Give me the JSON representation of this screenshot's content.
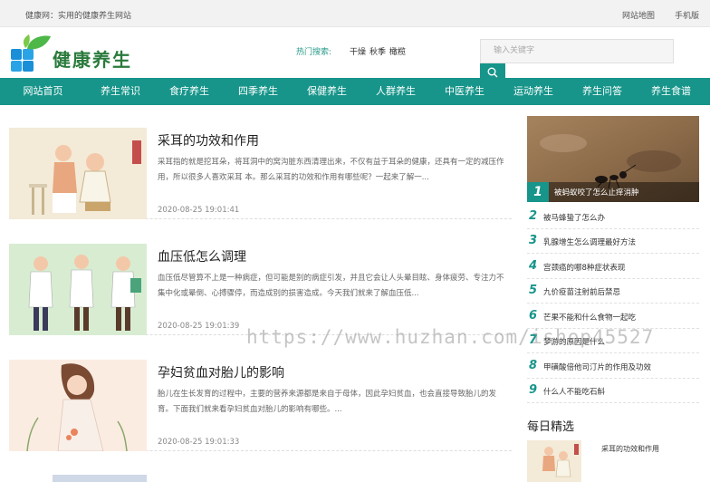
{
  "topbar": {
    "site_intro": "健康网：实用的健康养生网站",
    "links": [
      "网站地图",
      "手机版"
    ]
  },
  "header": {
    "logo_text": "健康养生",
    "hot_label": "热门搜索:",
    "hot_words": [
      "干燥",
      "秋季",
      "橄榄"
    ],
    "search_placeholder": "输入关键字"
  },
  "nav": [
    "网站首页",
    "养生常识",
    "食疗养生",
    "四季养生",
    "保健养生",
    "人群养生",
    "中医养生",
    "运动养生",
    "养生问答",
    "养生食谱"
  ],
  "articles": [
    {
      "title": "采耳的功效和作用",
      "desc": "采耳指的就是挖耳朵，将耳洞中的窝沟脏东西清理出来，不仅有益于耳朵的健康，还具有一定的减压作用，所以很多人喜欢采耳 本。那么采耳的功效和作用有哪些呢？一起来了解一...",
      "date": "2020-08-25 19:01:41"
    },
    {
      "title": "血压低怎么调理",
      "desc": "血压低尽管算不上是一种病症，但可能是别的病症引发，并且它会让人头晕目眩、身体疲劳、专注力不集中化或晕倒、心搏骤停，而造成别的损害造成。今天我们就来了解血压低...",
      "date": "2020-08-25 19:01:39"
    },
    {
      "title": "孕妇贫血对胎儿的影响",
      "desc": "胎儿在生长发育的过程中，主要的营养来源都是来自于母体，因此孕妇贫血，也会直接导致胎儿的发育。下面我们就来看孕妇贫血对胎儿的影响有哪些。...",
      "date": "2020-08-25 19:01:33"
    }
  ],
  "sidebar": {
    "hero_number": "1",
    "hero_caption": "被蚂蚁咬了怎么止痒消肿",
    "ranks": [
      {
        "n": "2",
        "t": "被马蜂蛰了怎么办"
      },
      {
        "n": "3",
        "t": "乳腺增生怎么调理最好方法"
      },
      {
        "n": "4",
        "t": "宫颈癌的哪8种症状表现"
      },
      {
        "n": "5",
        "t": "九价疫苗注射前后禁忌"
      },
      {
        "n": "6",
        "t": "芒果不能和什么食物一起吃"
      },
      {
        "n": "7",
        "t": "梦游的原因是什么"
      },
      {
        "n": "8",
        "t": "甲磺酸倍他司汀片的作用及功效"
      },
      {
        "n": "9",
        "t": "什么人不能吃石斛"
      }
    ],
    "daily_title": "每日精选",
    "daily_item": "采耳的功效和作用"
  },
  "watermark": "https://www.huzhan.com/ishop45527",
  "colors": {
    "accent": "#17958a",
    "logo_green": "#2a7a3c"
  }
}
